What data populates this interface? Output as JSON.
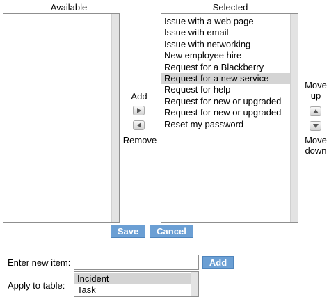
{
  "available": {
    "heading": "Available",
    "items": []
  },
  "selected": {
    "heading": "Selected",
    "items": [
      "Issue with a web page",
      "Issue with email",
      "Issue with networking",
      "New employee hire",
      "Request for a Blackberry",
      "Request for a new service",
      "Request for help",
      "Request for new or upgraded",
      "Request for new or upgraded",
      "Reset my password"
    ],
    "selected_index": 5
  },
  "transfer": {
    "add_label": "Add",
    "remove_label": "Remove",
    "add_icon": "arrow-right-icon",
    "remove_icon": "arrow-left-icon"
  },
  "ordering": {
    "move_up_line1": "Move",
    "move_up_line2": "up",
    "move_down_line1": "Move",
    "move_down_line2": "down",
    "up_icon": "arrow-up-icon",
    "down_icon": "arrow-down-icon"
  },
  "actions": {
    "save_label": "Save",
    "cancel_label": "Cancel"
  },
  "new_item": {
    "label": "Enter new item:",
    "value": "",
    "add_label": "Add"
  },
  "apply_table": {
    "label": "Apply to table:",
    "options": [
      "Incident",
      "Task"
    ],
    "selected_index": 0
  },
  "colors": {
    "button_blue": "#6b9fd4",
    "selection_gray": "#d4d4d4"
  }
}
